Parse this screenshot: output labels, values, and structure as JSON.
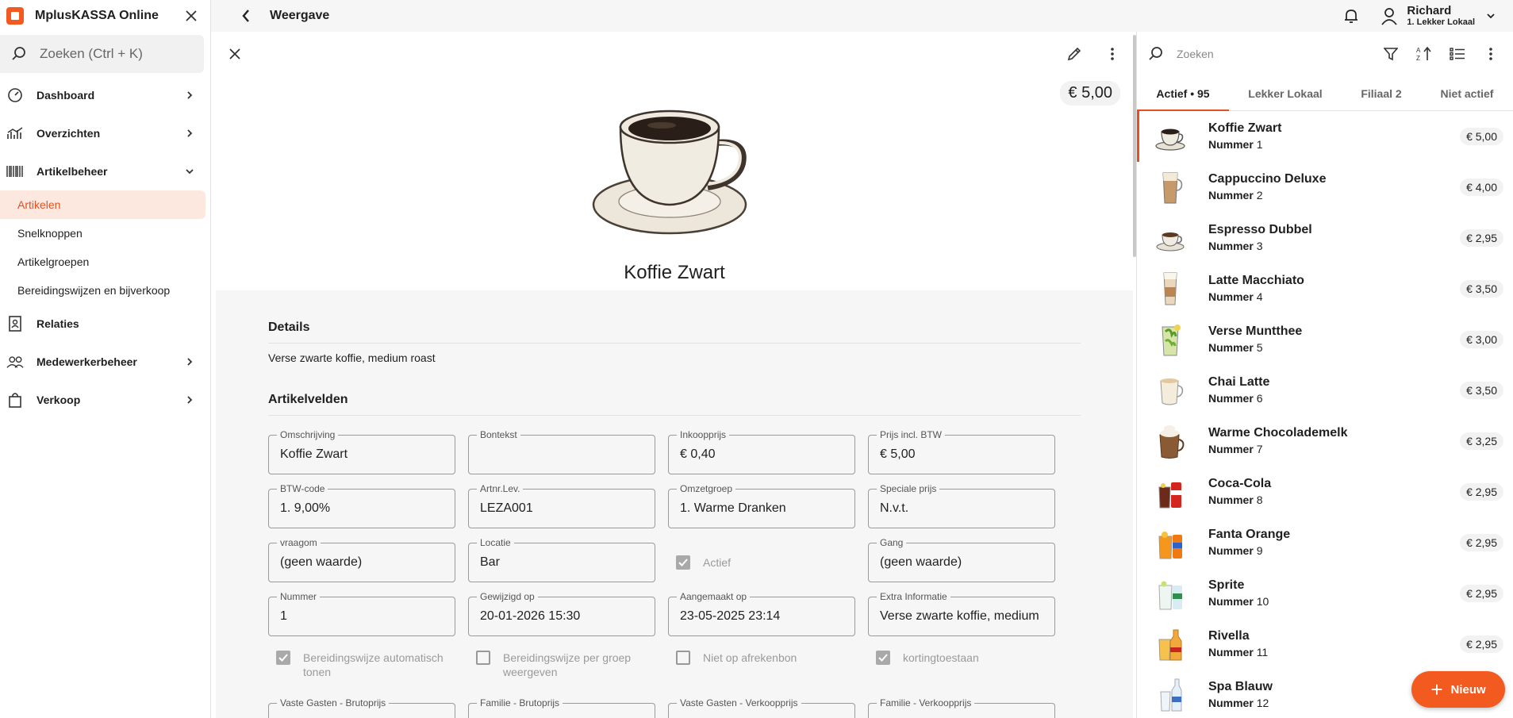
{
  "app": {
    "name": "MplusKASSA Online"
  },
  "sidebar": {
    "search_placeholder": "Zoeken (Ctrl + K)",
    "items": [
      {
        "label": "Dashboard"
      },
      {
        "label": "Overzichten"
      },
      {
        "label": "Artikelbeheer"
      },
      {
        "label": "Relaties"
      },
      {
        "label": "Medewerkerbeheer"
      },
      {
        "label": "Verkoop"
      }
    ],
    "subitems": [
      {
        "label": "Artikelen"
      },
      {
        "label": "Snelknoppen"
      },
      {
        "label": "Artikelgroepen"
      },
      {
        "label": "Bereidingswijzen en bijverkoop"
      }
    ]
  },
  "topbar": {
    "title": "Weergave",
    "user_name": "Richard",
    "user_branch": "1. Lekker Lokaal"
  },
  "detail": {
    "price": "€ 5,00",
    "title": "Koffie Zwart",
    "details_heading": "Details",
    "details_text": "Verse zwarte koffie, medium roast",
    "fields_heading": "Artikelvelden",
    "fields": [
      {
        "label": "Omschrijving",
        "value": "Koffie Zwart"
      },
      {
        "label": "Bontekst",
        "value": ""
      },
      {
        "label": "Inkoopprijs",
        "value": "€ 0,40"
      },
      {
        "label": "Prijs incl. BTW",
        "value": "€ 5,00"
      },
      {
        "label": "BTW-code",
        "value": "1. 9,00%"
      },
      {
        "label": "Artnr.Lev.",
        "value": "LEZA001"
      },
      {
        "label": "Omzetgroep",
        "value": "1. Warme Dranken"
      },
      {
        "label": "Speciale prijs",
        "value": "N.v.t."
      },
      {
        "label": "vraagom",
        "value": "(geen waarde)"
      },
      {
        "label": "Locatie",
        "value": "Bar"
      },
      {
        "label": "Actief",
        "value": ""
      },
      {
        "label": "Gang",
        "value": "(geen waarde)"
      },
      {
        "label": "Nummer",
        "value": "1"
      },
      {
        "label": "Gewijzigd op",
        "value": "20-01-2026 15:30"
      },
      {
        "label": "Aangemaakt op",
        "value": "23-05-2025 23:14"
      },
      {
        "label": "Extra Informatie",
        "value": "Verse zwarte koffie, medium roast"
      }
    ],
    "checks": [
      {
        "label": "Bereidingswijze automatisch tonen",
        "checked": true
      },
      {
        "label": "Bereidingswijze per groep weergeven",
        "checked": false
      },
      {
        "label": "Niet op afrekenbon",
        "checked": false
      },
      {
        "label": "kortingtoestaan",
        "checked": true
      }
    ],
    "cut_fields": [
      {
        "label": "Vaste Gasten - Brutoprijs"
      },
      {
        "label": "Familie - Brutoprijs"
      },
      {
        "label": "Vaste Gasten - Verkoopprijs"
      },
      {
        "label": "Familie - Verkoopprijs"
      }
    ]
  },
  "list": {
    "search_placeholder": "Zoeken",
    "tabs": [
      {
        "label": "Actief • 95"
      },
      {
        "label": "Lekker Lokaal"
      },
      {
        "label": "Filiaal 2"
      },
      {
        "label": "Niet actief"
      }
    ],
    "number_label": "Nummer",
    "items": [
      {
        "name": "Koffie Zwart",
        "number": "1",
        "price": "€ 5,00",
        "thumb": "coffee-cup"
      },
      {
        "name": "Cappuccino Deluxe",
        "number": "2",
        "price": "€ 4,00",
        "thumb": "cappuccino-glass"
      },
      {
        "name": "Espresso Dubbel",
        "number": "3",
        "price": "€ 2,95",
        "thumb": "espresso-cup"
      },
      {
        "name": "Latte Macchiato",
        "number": "4",
        "price": "€ 3,50",
        "thumb": "latte-glass"
      },
      {
        "name": "Verse Muntthee",
        "number": "5",
        "price": "€ 3,00",
        "thumb": "mint-tea-glass"
      },
      {
        "name": "Chai Latte",
        "number": "6",
        "price": "€ 3,50",
        "thumb": "chai-mug"
      },
      {
        "name": "Warme Chocolademelk",
        "number": "7",
        "price": "€ 3,25",
        "thumb": "hot-chocolate-mug"
      },
      {
        "name": "Coca-Cola",
        "number": "8",
        "price": "€ 2,95",
        "thumb": "cola-drink"
      },
      {
        "name": "Fanta Orange",
        "number": "9",
        "price": "€ 2,95",
        "thumb": "fanta-drink"
      },
      {
        "name": "Sprite",
        "number": "10",
        "price": "€ 2,95",
        "thumb": "sprite-drink"
      },
      {
        "name": "Rivella",
        "number": "11",
        "price": "€ 2,95",
        "thumb": "rivella-drink"
      },
      {
        "name": "Spa Blauw",
        "number": "12",
        "price": "",
        "thumb": "water-bottle"
      }
    ]
  },
  "fab": {
    "label": "Nieuw"
  },
  "colors": {
    "accent": "#f25a1f",
    "active_bg": "#fde8e0"
  }
}
